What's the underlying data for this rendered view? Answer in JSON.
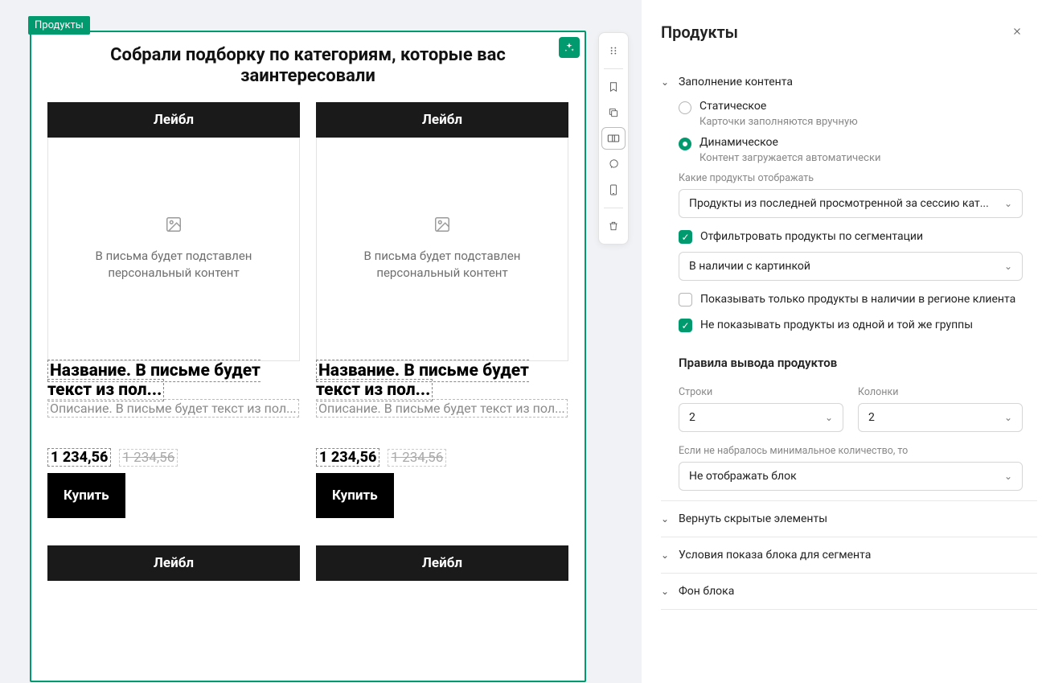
{
  "tag": "Продукты",
  "canvas": {
    "title": "Собрали подборку по категориям, которые вас заинтересовали",
    "label": "Лейбл",
    "image_placeholder": "В письма будет подставлен персональный контент",
    "product_title": "Название. В письме будет текст из пол...",
    "product_desc": "Описание. В письме будет текст из пол...",
    "price": "1 234,56",
    "price_old": "1 234,56",
    "buy": "Купить"
  },
  "panel": {
    "title": "Продукты",
    "section_fill": "Заполнение контента",
    "radio_static_label": "Статическое",
    "radio_static_sub": "Карточки заполняются вручную",
    "radio_dynamic_label": "Динамическое",
    "radio_dynamic_sub": "Контент загружается автоматически",
    "what_products_label": "Какие продукты отображать",
    "what_products_value": "Продукты из последней просмотренной за сессию кат...",
    "check_filter": "Отфильтровать продукты по сегментации",
    "filter_value": "В наличии с картинкой",
    "check_region": "Показывать только продукты в наличии в регионе клиента",
    "check_group": "Не показывать продукты из одной и той же группы",
    "rules_head": "Правила вывода продуктов",
    "rows_label": "Строки",
    "rows_value": "2",
    "cols_label": "Колонки",
    "cols_value": "2",
    "fallback_label": "Если не набралось минимальное количество, то",
    "fallback_value": "Не отображать блок",
    "sec_return": "Вернуть скрытые элементы",
    "sec_conditions": "Условия показа блока для сегмента",
    "sec_bg": "Фон блока"
  }
}
